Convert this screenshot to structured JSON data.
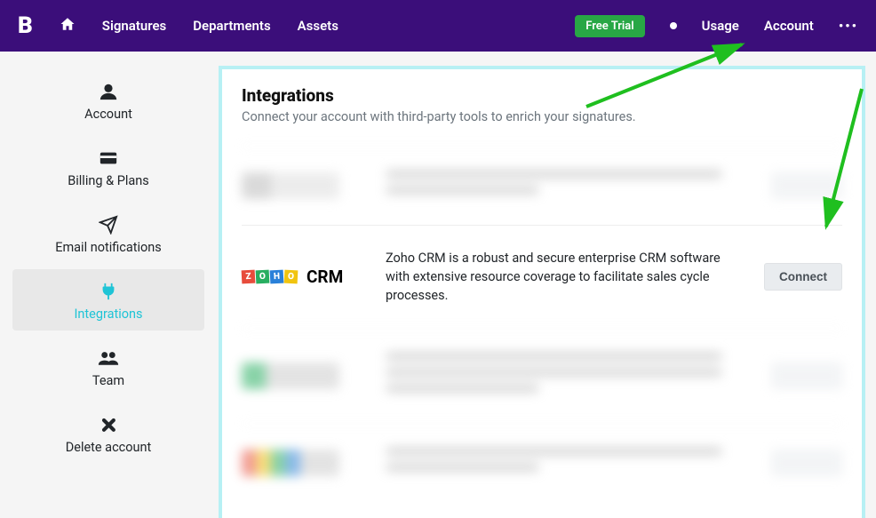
{
  "nav": {
    "logo": "B",
    "items": [
      "Signatures",
      "Departments",
      "Assets"
    ],
    "freeTrial": "Free Trial",
    "usage": "Usage",
    "account": "Account"
  },
  "sidebar": {
    "items": [
      {
        "label": "Account"
      },
      {
        "label": "Billing & Plans"
      },
      {
        "label": "Email notifications"
      },
      {
        "label": "Integrations"
      },
      {
        "label": "Team"
      },
      {
        "label": "Delete account"
      }
    ]
  },
  "panel": {
    "title": "Integrations",
    "subtitle": "Connect your account with third-party tools to enrich your signatures."
  },
  "integrations": {
    "zoho": {
      "name": "CRM",
      "desc": "Zoho CRM is a robust and secure enterprise CRM software with extensive resource coverage to facilitate sales cycle processes.",
      "action": "Connect"
    }
  }
}
